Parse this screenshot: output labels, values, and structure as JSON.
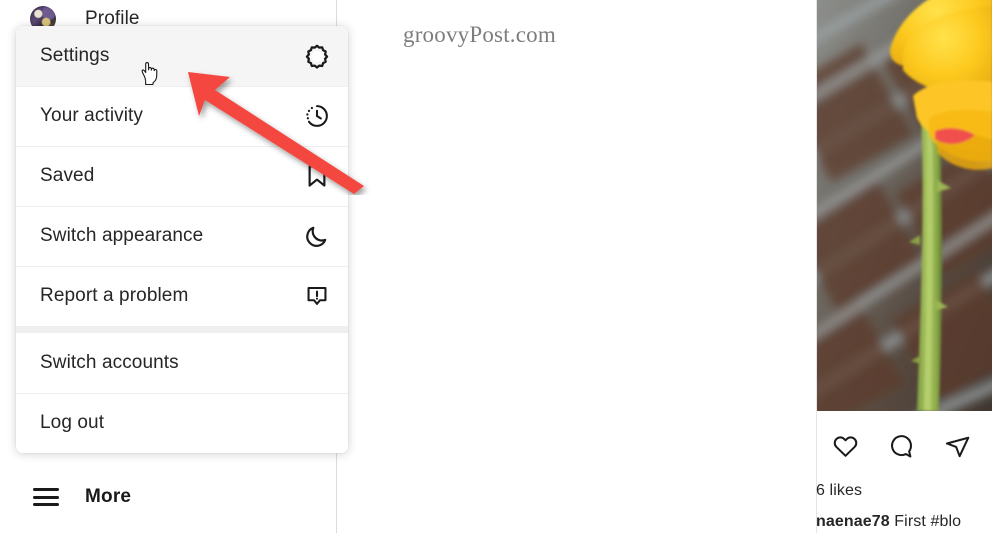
{
  "watermark": {
    "text": "groovyPost.com"
  },
  "sidebar": {
    "profile": {
      "label": "Profile",
      "avatar_icon": "user-avatar-image"
    },
    "more": {
      "label": "More",
      "icon": "hamburger-menu-icon"
    }
  },
  "flyout_menu": {
    "groups": [
      {
        "items": [
          {
            "label": "Settings",
            "icon": "gear-icon",
            "active": true
          },
          {
            "label": "Your activity",
            "icon": "clock-activity-icon",
            "active": false
          },
          {
            "label": "Saved",
            "icon": "bookmark-icon",
            "active": false
          },
          {
            "label": "Switch appearance",
            "icon": "crescent-moon-icon",
            "active": false
          },
          {
            "label": "Report a problem",
            "icon": "report-problem-icon",
            "active": false
          }
        ]
      },
      {
        "items": [
          {
            "label": "Switch accounts",
            "icon": "",
            "active": false
          },
          {
            "label": "Log out",
            "icon": "",
            "active": false
          }
        ]
      }
    ]
  },
  "post": {
    "photo_alt": "yellow-rose-photo",
    "actions": [
      {
        "name": "like-icon",
        "label": "Like"
      },
      {
        "name": "comment-icon",
        "label": "Comment"
      },
      {
        "name": "share-icon",
        "label": "Share"
      }
    ],
    "likes": "6 likes",
    "caption_username": "naenae78",
    "caption_text": " First #blo"
  },
  "annotation": {
    "arrow_color": "#f4473f",
    "cursor_icon": "pointing-hand-cursor"
  },
  "colors": {
    "accent_red": "#f4473f",
    "text_primary": "#262626",
    "border": "#dbdbdb",
    "highlight": "#f5f5f5"
  }
}
